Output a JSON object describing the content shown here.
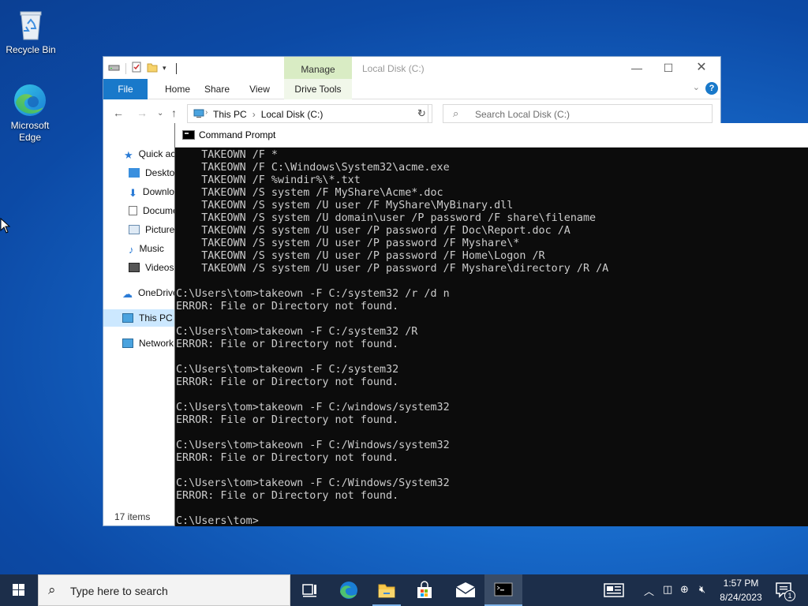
{
  "desktop": {
    "icons": [
      {
        "name": "recycle-bin",
        "label": "Recycle Bin"
      },
      {
        "name": "edge",
        "label": "Microsoft\nEdge",
        "line1": "Microsoft",
        "line2": "Edge"
      }
    ]
  },
  "explorer": {
    "title": "Local Disk (C:)",
    "context_tab": "Manage",
    "ribbon_tabs": [
      "File",
      "Home",
      "Share",
      "View",
      "Drive Tools"
    ],
    "help": "?",
    "breadcrumb": [
      "This PC",
      "Local Disk (C:)"
    ],
    "search_placeholder": "Search Local Disk (C:)",
    "nav_items": [
      {
        "label": "Quick access",
        "icon": "star-icon"
      },
      {
        "label": "Desktop",
        "icon": "desktop-folder-icon"
      },
      {
        "label": "Downloads",
        "icon": "download-icon"
      },
      {
        "label": "Documents",
        "icon": "documents-icon"
      },
      {
        "label": "Pictures",
        "icon": "pictures-icon"
      },
      {
        "label": "Music",
        "icon": "music-icon"
      },
      {
        "label": "Videos",
        "icon": "videos-icon"
      },
      {
        "label": "OneDrive",
        "icon": "cloud-icon"
      },
      {
        "label": "This PC",
        "icon": "computer-icon",
        "selected": true
      },
      {
        "label": "Network",
        "icon": "network-icon"
      }
    ],
    "status": "17 items"
  },
  "cmd": {
    "title": "Command Prompt",
    "lines": [
      "    TAKEOWN /F *",
      "    TAKEOWN /F C:\\Windows\\System32\\acme.exe",
      "    TAKEOWN /F %windir%\\*.txt",
      "    TAKEOWN /S system /F MyShare\\Acme*.doc",
      "    TAKEOWN /S system /U user /F MyShare\\MyBinary.dll",
      "    TAKEOWN /S system /U domain\\user /P password /F share\\filename",
      "    TAKEOWN /S system /U user /P password /F Doc\\Report.doc /A",
      "    TAKEOWN /S system /U user /P password /F Myshare\\*",
      "    TAKEOWN /S system /U user /P password /F Home\\Logon /R",
      "    TAKEOWN /S system /U user /P password /F Myshare\\directory /R /A",
      "",
      "C:\\Users\\tom>takeown -F C:/system32 /r /d n",
      "ERROR: File or Directory not found.",
      "",
      "C:\\Users\\tom>takeown -F C:/system32 /R",
      "ERROR: File or Directory not found.",
      "",
      "C:\\Users\\tom>takeown -F C:/system32",
      "ERROR: File or Directory not found.",
      "",
      "C:\\Users\\tom>takeown -F C:/windows/system32",
      "ERROR: File or Directory not found.",
      "",
      "C:\\Users\\tom>takeown -F C:/Windows/system32",
      "ERROR: File or Directory not found.",
      "",
      "C:\\Users\\tom>takeown -F C:/Windows/System32",
      "ERROR: File or Directory not found.",
      "",
      "C:\\Users\\tom>"
    ]
  },
  "taskbar": {
    "search_placeholder": "Type here to search",
    "time": "1:57 PM",
    "date": "8/24/2023",
    "notification_count": "1"
  }
}
